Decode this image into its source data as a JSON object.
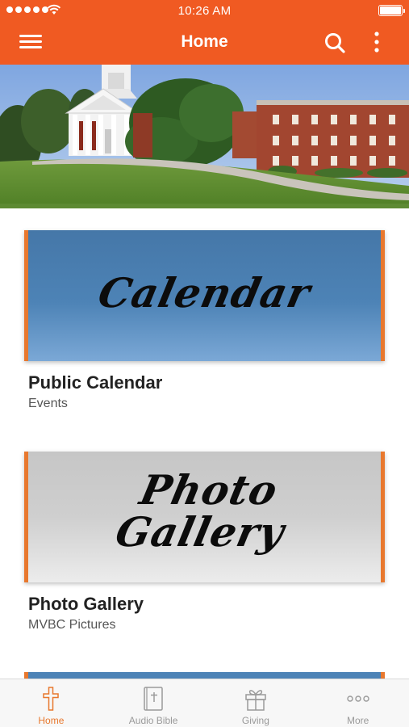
{
  "status_bar": {
    "time": "10:26 AM"
  },
  "nav": {
    "title": "Home"
  },
  "hero": {
    "alt": "Church building"
  },
  "cards": [
    {
      "banner_text": "Calendar",
      "title": "Public Calendar",
      "subtitle": "Events"
    },
    {
      "banner_text_line1": "Photo",
      "banner_text_line2": "Gallery",
      "title": "Photo Gallery",
      "subtitle": "MVBC Pictures"
    }
  ],
  "tabs": [
    {
      "label": "Home",
      "icon": "cross-icon",
      "active": true
    },
    {
      "label": "Audio Bible",
      "icon": "bible-icon",
      "active": false
    },
    {
      "label": "Giving",
      "icon": "gift-icon",
      "active": false
    },
    {
      "label": "More",
      "icon": "more-icon",
      "active": false
    }
  ],
  "colors": {
    "brand": "#f05a22",
    "accent": "#e8782e",
    "inactive": "#9a9a9a"
  }
}
